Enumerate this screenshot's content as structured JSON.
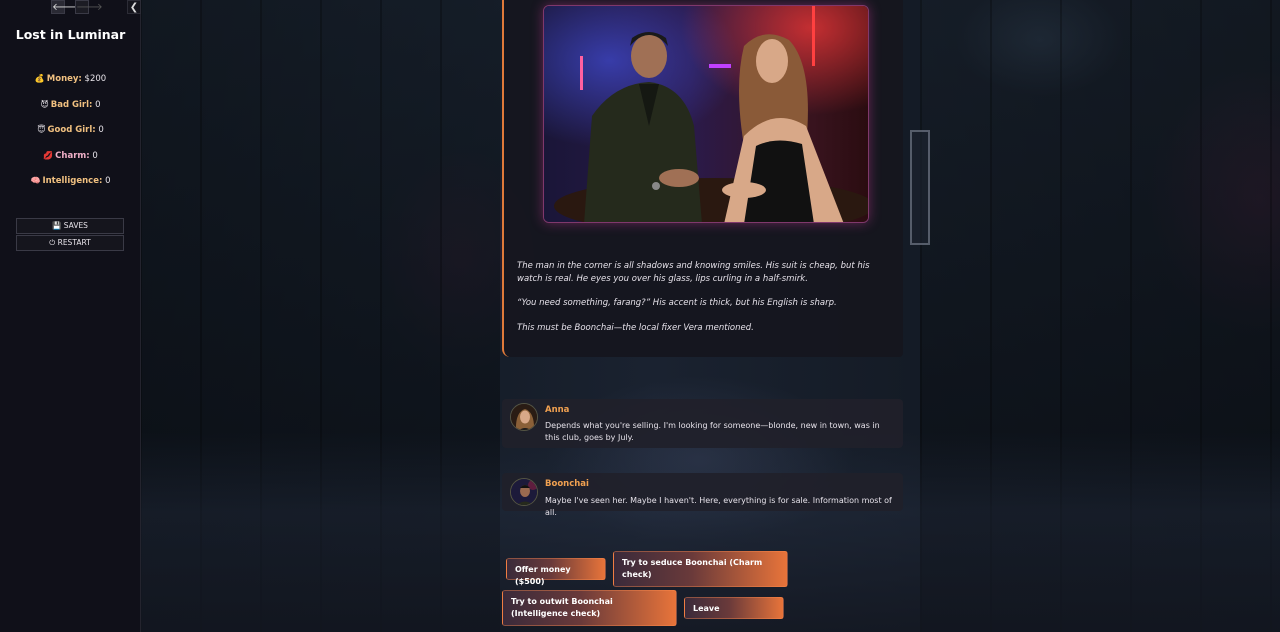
{
  "game": {
    "title": "Lost in Luminar"
  },
  "nav": {
    "back_glyph": "🡐",
    "forward_glyph": "🡒",
    "collapse_glyph": "❮"
  },
  "stats": [
    {
      "icon": "💰",
      "label": "Money:",
      "value": "$200"
    },
    {
      "icon": "😈",
      "label": "Bad Girl:",
      "value": "0"
    },
    {
      "icon": "😇",
      "label": "Good Girl:",
      "value": "0"
    },
    {
      "icon": "💋",
      "label": "Charm:",
      "value": "0"
    },
    {
      "icon": "🧠",
      "label": "Intelligence:",
      "value": "0"
    }
  ],
  "menu": {
    "saves": "SAVES",
    "restart": "RESTART",
    "saves_icon": "💾",
    "restart_icon": "⏻"
  },
  "story": {
    "paragraphs": [
      "The man in the corner is all shadows and knowing smiles. His suit is cheap, but his watch is real. He eyes you over his glass, lips curling in a half-smirk.",
      "“You need something, farang?” His accent is thick, but his English is sharp.",
      "This must be Boonchai—the local fixer Vera mentioned."
    ]
  },
  "dialogue": [
    {
      "speaker": "Anna",
      "text": "Depends what you're selling. I'm looking for someone—blonde, new in town, was in this club, goes by July."
    },
    {
      "speaker": "Boonchai",
      "text": "Maybe I've seen her. Maybe I haven't. Here, everything is for sale. Information most of all."
    }
  ],
  "choices": [
    {
      "label": "Offer money ($500)"
    },
    {
      "label": "Try to seduce Boonchai (Charm check)"
    },
    {
      "label": "Try to outwit Boonchai (Intelligence check)"
    },
    {
      "label": "Leave"
    }
  ],
  "colors": {
    "accent": "#e07a3a",
    "speaker": "#f0a050"
  }
}
